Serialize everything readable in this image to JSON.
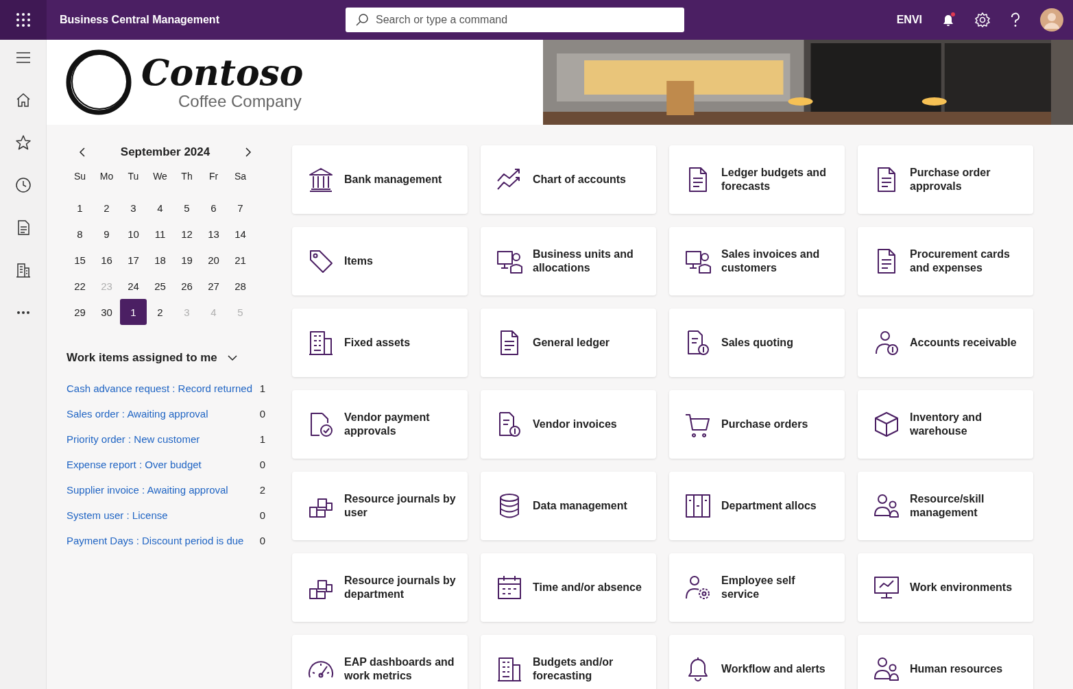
{
  "app_title": "Business Central Management",
  "search": {
    "placeholder": "Search or type a command"
  },
  "environment": "ENVI",
  "notifications": {
    "unread": true
  },
  "logo": {
    "name": "Contoso",
    "tagline": "Coffee Company"
  },
  "calendar": {
    "month": "September 2024",
    "weekdays": [
      "Su",
      "Mo",
      "Tu",
      "We",
      "Th",
      "Fr",
      "Sa"
    ],
    "days": [
      {
        "label": "1",
        "muted": false,
        "selected": false
      },
      {
        "label": "2",
        "muted": false,
        "selected": false
      },
      {
        "label": "3",
        "muted": false,
        "selected": false
      },
      {
        "label": "4",
        "muted": false,
        "selected": false
      },
      {
        "label": "5",
        "muted": false,
        "selected": false
      },
      {
        "label": "6",
        "muted": false,
        "selected": false
      },
      {
        "label": "7",
        "muted": false,
        "selected": false
      },
      {
        "label": "8",
        "muted": false,
        "selected": false
      },
      {
        "label": "9",
        "muted": false,
        "selected": false
      },
      {
        "label": "10",
        "muted": false,
        "selected": false
      },
      {
        "label": "11",
        "muted": false,
        "selected": false
      },
      {
        "label": "12",
        "muted": false,
        "selected": false
      },
      {
        "label": "13",
        "muted": false,
        "selected": false
      },
      {
        "label": "14",
        "muted": false,
        "selected": false
      },
      {
        "label": "15",
        "muted": false,
        "selected": false
      },
      {
        "label": "16",
        "muted": false,
        "selected": false
      },
      {
        "label": "17",
        "muted": false,
        "selected": false
      },
      {
        "label": "18",
        "muted": false,
        "selected": false
      },
      {
        "label": "19",
        "muted": false,
        "selected": false
      },
      {
        "label": "20",
        "muted": false,
        "selected": false
      },
      {
        "label": "21",
        "muted": false,
        "selected": false
      },
      {
        "label": "22",
        "muted": false,
        "selected": false
      },
      {
        "label": "23",
        "muted": true,
        "selected": false
      },
      {
        "label": "24",
        "muted": false,
        "selected": false
      },
      {
        "label": "25",
        "muted": false,
        "selected": false
      },
      {
        "label": "26",
        "muted": false,
        "selected": false
      },
      {
        "label": "27",
        "muted": false,
        "selected": false
      },
      {
        "label": "28",
        "muted": false,
        "selected": false
      },
      {
        "label": "29",
        "muted": false,
        "selected": false
      },
      {
        "label": "30",
        "muted": false,
        "selected": false
      },
      {
        "label": "1",
        "muted": false,
        "selected": true
      },
      {
        "label": "2",
        "muted": false,
        "selected": false
      },
      {
        "label": "3",
        "muted": true,
        "selected": false
      },
      {
        "label": "4",
        "muted": true,
        "selected": false
      },
      {
        "label": "5",
        "muted": true,
        "selected": false
      }
    ]
  },
  "work_items": {
    "title": "Work items assigned to me",
    "expanded": true,
    "items": [
      {
        "label": "Cash advance request : Record returned",
        "count": "1"
      },
      {
        "label": "Sales order : Awaiting approval",
        "count": "0"
      },
      {
        "label": "Priority order : New customer",
        "count": "1"
      },
      {
        "label": "Expense report : Over budget",
        "count": "0"
      },
      {
        "label": "Supplier invoice : Awaiting approval",
        "count": "2"
      },
      {
        "label": "System user : License",
        "count": "0"
      },
      {
        "label": "Payment Days : Discount period is due",
        "count": "0"
      }
    ]
  },
  "tiles": [
    {
      "label": "Bank management"
    },
    {
      "label": "Chart of accounts"
    },
    {
      "label": "Ledger budgets and forecasts"
    },
    {
      "label": "Purchase order approvals"
    },
    {
      "label": "Items"
    },
    {
      "label": "Business units and allocations"
    },
    {
      "label": "Sales invoices and customers"
    },
    {
      "label": "Procurement cards and expenses"
    },
    {
      "label": "Fixed assets"
    },
    {
      "label": "General ledger"
    },
    {
      "label": "Sales quoting"
    },
    {
      "label": "Accounts receivable"
    },
    {
      "label": "Vendor payment approvals"
    },
    {
      "label": "Vendor invoices"
    },
    {
      "label": "Purchase orders"
    },
    {
      "label": "Inventory and warehouse"
    },
    {
      "label": "Resource journals by user"
    },
    {
      "label": "Data management"
    },
    {
      "label": "Department allocs"
    },
    {
      "label": "Resource/skill management"
    },
    {
      "label": "Resource journals by department"
    },
    {
      "label": "Time and/or absence"
    },
    {
      "label": "Employee self service"
    },
    {
      "label": "Work environments"
    },
    {
      "label": "EAP dashboards and work metrics"
    },
    {
      "label": "Budgets and/or forecasting"
    },
    {
      "label": "Workflow and alerts"
    },
    {
      "label": "Human resources"
    }
  ]
}
